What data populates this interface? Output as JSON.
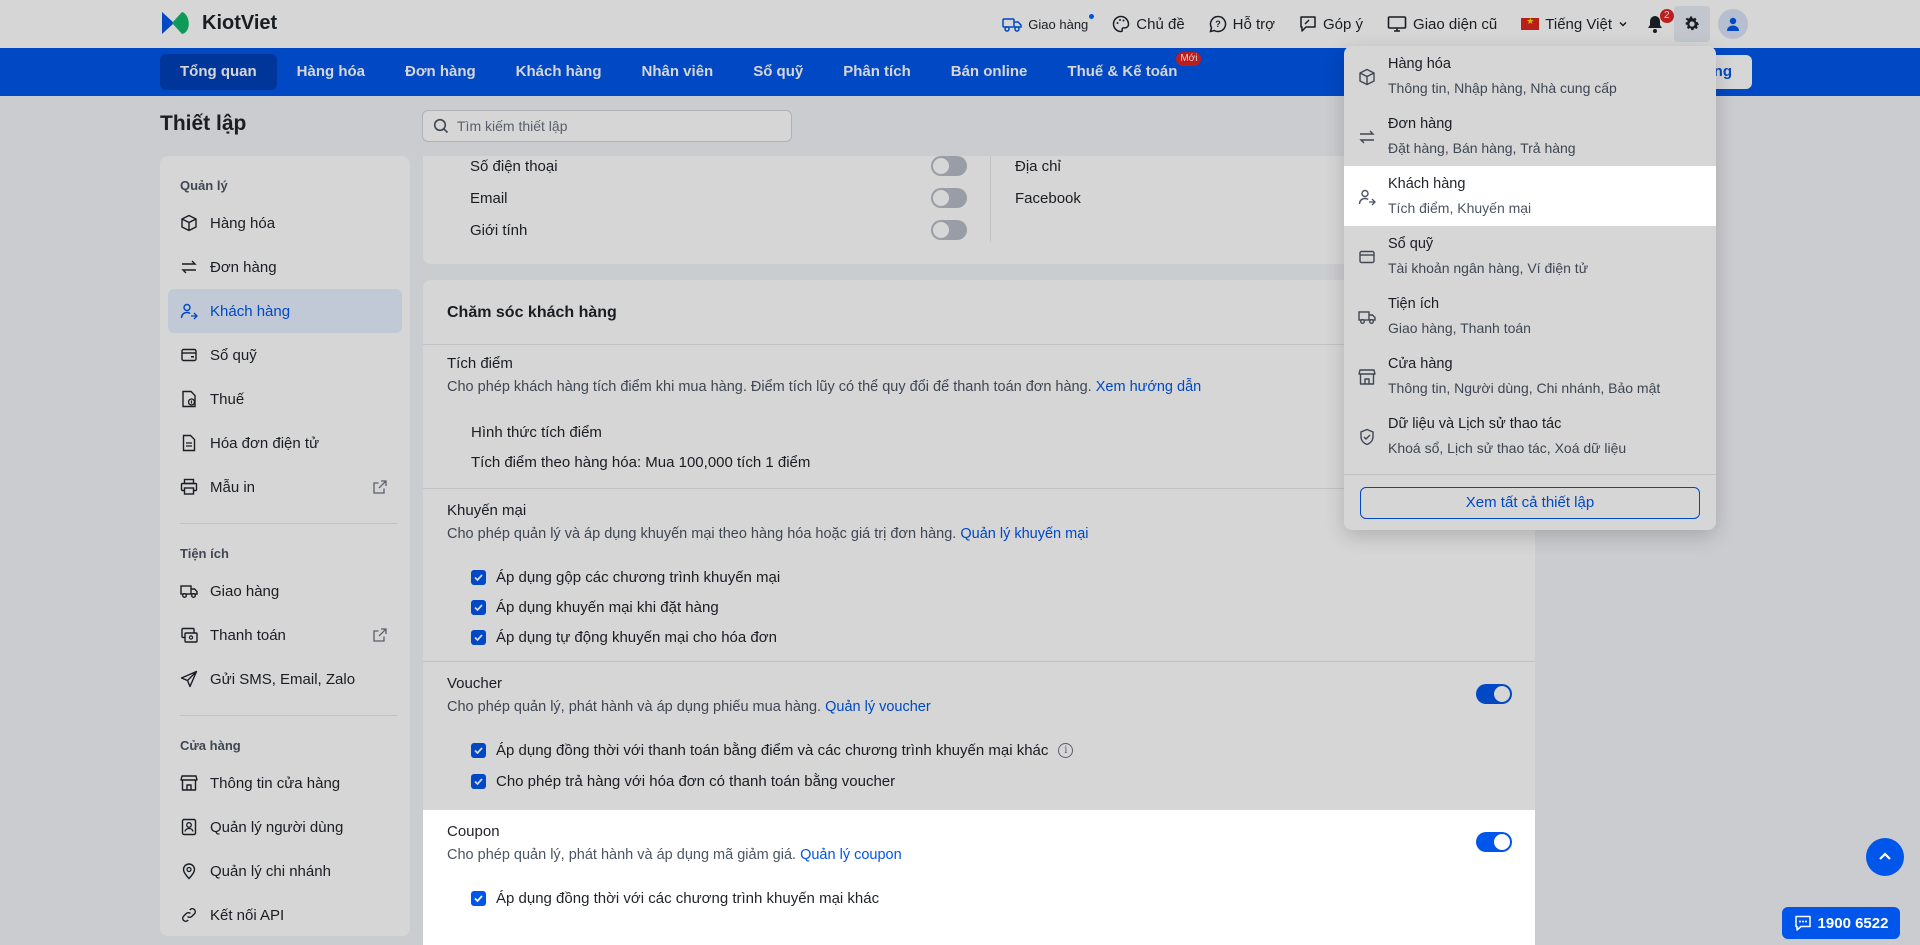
{
  "brand": {
    "name": "KiotViet"
  },
  "topbar": {
    "delivery": "Giao hàng",
    "theme": "Chủ đề",
    "support": "Hỗ trợ",
    "feedback": "Góp ý",
    "old_ui": "Giao diện cũ",
    "language": "Tiếng Việt",
    "notification_count": "2"
  },
  "nav": {
    "tabs": [
      "Tổng quan",
      "Hàng hóa",
      "Đơn hàng",
      "Khách hàng",
      "Nhân viên",
      "Sổ quỹ",
      "Phân tích",
      "Bán online",
      "Thuế & Kế toán"
    ],
    "new_badge": "Mới",
    "right_button_partial": "ng"
  },
  "page": {
    "title": "Thiết lập",
    "search_placeholder": "Tìm kiếm thiết lập"
  },
  "sidebar": {
    "sections": [
      {
        "title": "Quản lý",
        "items": [
          "Hàng hóa",
          "Đơn hàng",
          "Khách hàng",
          "Sổ quỹ",
          "Thuế",
          "Hóa đơn điện tử",
          "Mẫu in"
        ]
      },
      {
        "title": "Tiện ích",
        "items": [
          "Giao hàng",
          "Thanh toán",
          "Gửi SMS, Email, Zalo"
        ]
      },
      {
        "title": "Cửa hàng",
        "items": [
          "Thông tin cửa hàng",
          "Quản lý người dùng",
          "Quản lý chi nhánh",
          "Kết nối API"
        ]
      }
    ]
  },
  "fields": {
    "phone": "Số điện thoại",
    "email": "Email",
    "gender": "Giới tính",
    "address": "Địa chỉ",
    "facebook": "Facebook"
  },
  "care": {
    "title": "Chăm sóc khách hàng",
    "points": {
      "title": "Tích điểm",
      "desc": "Cho phép khách hàng tích điểm khi mua hàng. Điểm tích lũy có thể quy đổi để thanh toán đơn hàng.",
      "link": "Xem hướng dẫn",
      "method_label": "Hình thức tích điểm",
      "method_value": "Tích điểm theo hàng hóa: Mua 100,000 tích 1 điểm"
    },
    "promo": {
      "title": "Khuyến mại",
      "desc": "Cho phép quản lý và áp dụng khuyến mại theo hàng hóa hoặc giá trị đơn hàng.",
      "link": "Quản lý khuyến mại",
      "options": [
        "Áp dụng gộp các chương trình khuyến mại",
        "Áp dụng khuyến mại khi đặt hàng",
        "Áp dụng tự động khuyến mại cho hóa đơn"
      ]
    },
    "voucher": {
      "title": "Voucher",
      "desc": "Cho phép quản lý, phát hành và áp dụng phiếu mua hàng.",
      "link": "Quản lý voucher",
      "options": [
        "Áp dụng đồng thời với thanh toán bằng điểm và các chương trình khuyến mại khác",
        "Cho phép trả hàng với hóa đơn có thanh toán bằng voucher"
      ]
    },
    "coupon": {
      "title": "Coupon",
      "desc": "Cho phép quản lý, phát hành và áp dụng mã giảm giá.",
      "link": "Quản lý coupon",
      "options": [
        "Áp dụng đồng thời với các chương trình khuyến mại khác"
      ]
    }
  },
  "dropdown": {
    "items": [
      {
        "title": "Hàng hóa",
        "sub": "Thông tin, Nhập hàng, Nhà cung cấp",
        "icon": "box-icon"
      },
      {
        "title": "Đơn hàng",
        "sub": "Đặt hàng, Bán hàng, Trả hàng",
        "icon": "swap-icon"
      },
      {
        "title": "Khách hàng",
        "sub": "Tích điểm, Khuyến mại",
        "icon": "customer-icon"
      },
      {
        "title": "Sổ quỹ",
        "sub": "Tài khoản ngân hàng, Ví điện tử",
        "icon": "wallet-icon"
      },
      {
        "title": "Tiện ích",
        "sub": "Giao hàng, Thanh toán",
        "icon": "truck-icon"
      },
      {
        "title": "Cửa hàng",
        "sub": "Thông tin, Người dùng, Chi nhánh, Bảo mật",
        "icon": "store-icon"
      },
      {
        "title": "Dữ liệu và Lịch sử thao tác",
        "sub": "Khoá sổ, Lịch sử thao tác, Xoá dữ liệu",
        "icon": "shield-icon"
      }
    ],
    "view_all": "Xem tất cả thiết lập"
  },
  "hotline": "1900 6522",
  "colors": {
    "primary": "#0056ea",
    "badge": "#e02424"
  }
}
